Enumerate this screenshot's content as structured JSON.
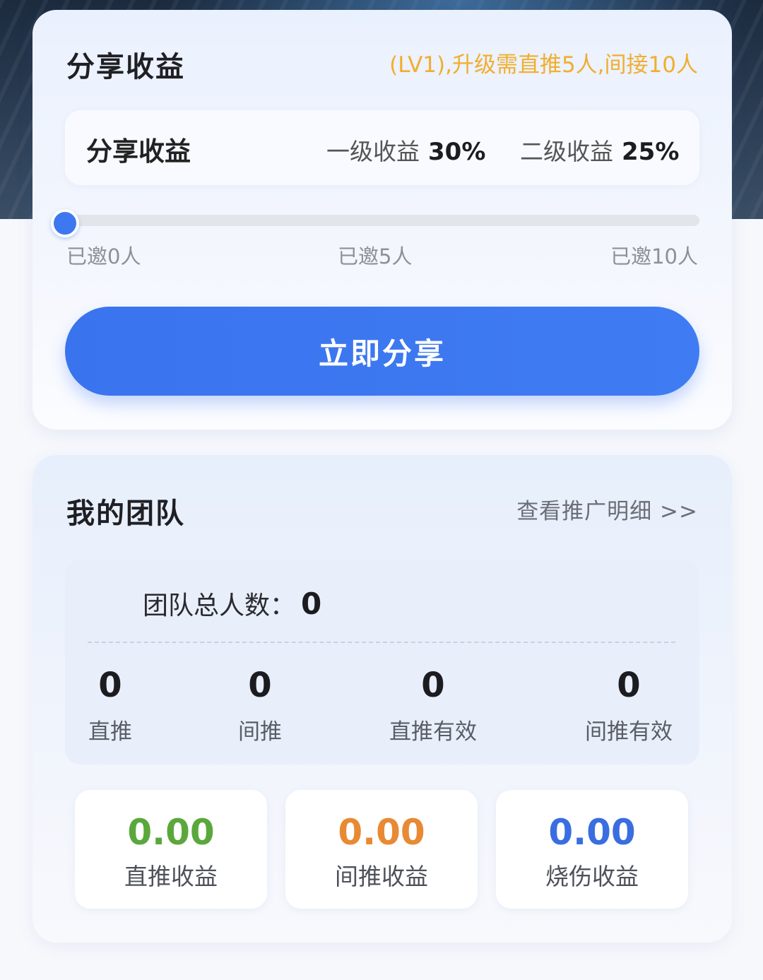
{
  "share": {
    "title": "分享收益",
    "level_hint": "(LV1),升级需直推5人,间接10人",
    "rate_title": "分享收益",
    "level1_label": "一级收益",
    "level1_value": "30%",
    "level2_label": "二级收益",
    "level2_value": "25%",
    "progress_fraction": 0,
    "ticks": [
      "已邀0人",
      "已邀5人",
      "已邀10人"
    ],
    "button_label": "立即分享"
  },
  "team": {
    "title": "我的团队",
    "detail_link": "查看推广明细 >>",
    "total_label": "团队总人数：",
    "total_value": "0",
    "stats": [
      {
        "value": "0",
        "label": "直推"
      },
      {
        "value": "0",
        "label": "间推"
      },
      {
        "value": "0",
        "label": "直推有效"
      },
      {
        "value": "0",
        "label": "间推有效"
      }
    ],
    "earnings": [
      {
        "amount": "0.00",
        "label": "直推收益",
        "color": "#5aa83c"
      },
      {
        "amount": "0.00",
        "label": "间推收益",
        "color": "#e88a34"
      },
      {
        "amount": "0.00",
        "label": "烧伤收益",
        "color": "#3a6ee0"
      }
    ]
  },
  "colors": {
    "accent": "#3d78f1",
    "level_hint": "#f1ae2e"
  }
}
